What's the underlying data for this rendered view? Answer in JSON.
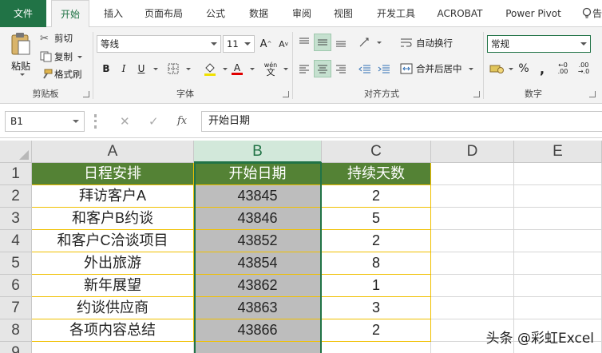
{
  "tabs": [
    {
      "label": "文件"
    },
    {
      "label": "开始"
    },
    {
      "label": "插入"
    },
    {
      "label": "页面布局"
    },
    {
      "label": "公式"
    },
    {
      "label": "数据"
    },
    {
      "label": "审阅"
    },
    {
      "label": "视图"
    },
    {
      "label": "开发工具"
    },
    {
      "label": "ACROBAT"
    },
    {
      "label": "Power Pivot"
    },
    {
      "label": "告"
    }
  ],
  "clipboard": {
    "paste": "粘贴",
    "cut": "剪切",
    "copy": "复制",
    "format_painter": "格式刷",
    "group_label": "剪贴板"
  },
  "font": {
    "family": "等线",
    "size": "11",
    "bold": "B",
    "italic": "I",
    "underline": "U",
    "font_color_glyph": "A",
    "phonetic": "wén",
    "group_label": "字体"
  },
  "alignment": {
    "wrap_text": "自动换行",
    "merge_center": "合并后居中",
    "group_label": "对齐方式"
  },
  "number": {
    "format": "常规",
    "percent": "%",
    "comma": ",",
    "group_label": "数字"
  },
  "formula_bar": {
    "name_box": "B1",
    "fx": "fx",
    "cancel": "✕",
    "enter": "✓",
    "content": "开始日期"
  },
  "columns": [
    "A",
    "B",
    "C",
    "D",
    "E"
  ],
  "rows": [
    "1",
    "2",
    "3",
    "4",
    "5",
    "6",
    "7",
    "8",
    "9"
  ],
  "table": {
    "headers": [
      "日程安排",
      "开始日期",
      "持续天数"
    ],
    "rows": [
      [
        "拜访客户A",
        "43845",
        "2"
      ],
      [
        "和客户B约谈",
        "43846",
        "5"
      ],
      [
        "和客户C洽谈项目",
        "43852",
        "2"
      ],
      [
        "外出旅游",
        "43854",
        "8"
      ],
      [
        "新年展望",
        "43862",
        "1"
      ],
      [
        "约谈供应商",
        "43863",
        "3"
      ],
      [
        "各项内容总结",
        "43866",
        "2"
      ]
    ]
  },
  "watermark": "头条 @彩虹Excel",
  "colors": {
    "accent": "#217346",
    "header_fill": "#548235",
    "border_gold": "#f0c000",
    "selected_fill": "#bdbdbd"
  }
}
